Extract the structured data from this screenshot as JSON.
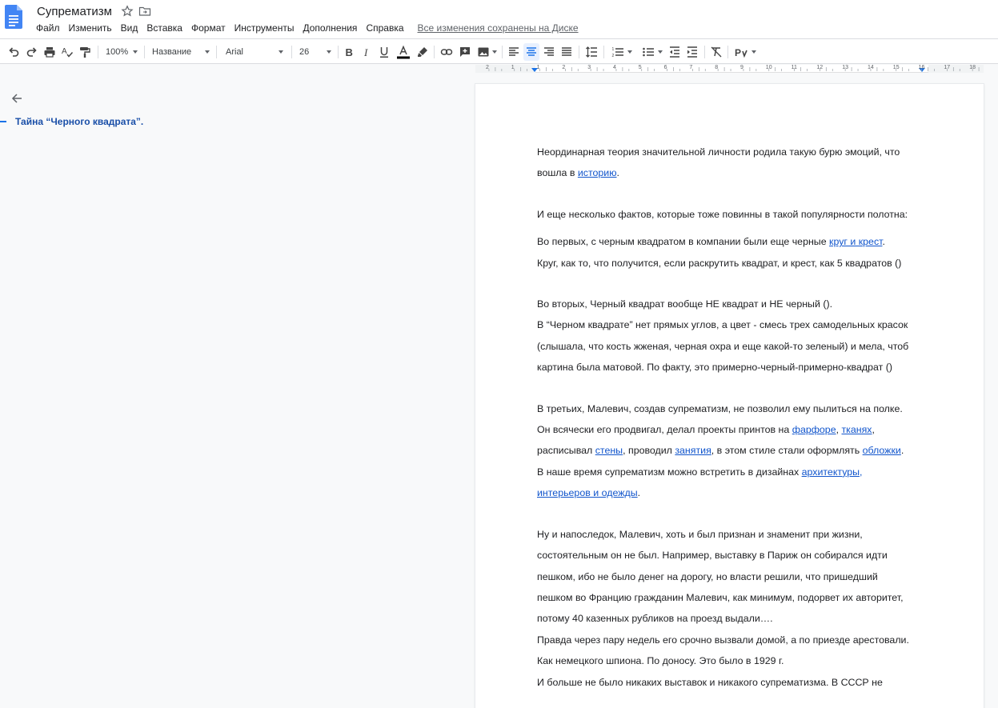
{
  "header": {
    "title": "Супрематизм",
    "menu": [
      "Файл",
      "Изменить",
      "Вид",
      "Вставка",
      "Формат",
      "Инструменты",
      "Дополнения",
      "Справка"
    ],
    "saved_status": "Все изменения сохранены на Диске"
  },
  "toolbar": {
    "zoom": "100%",
    "style": "Название",
    "font": "Arial",
    "size": "26"
  },
  "ruler": {
    "numbers": [
      "2",
      "1",
      "1",
      "2",
      "3",
      "4",
      "5",
      "6",
      "7",
      "8",
      "9",
      "10",
      "11",
      "12",
      "13",
      "14",
      "15",
      "16",
      "17",
      "18"
    ]
  },
  "outline": {
    "items": [
      "Тайна “Черного квадрата”."
    ]
  },
  "doc": {
    "p1a": "Неординарная теория значительной личности родила такую бурю эмоций, что",
    "p1b_pre": "вошла в ",
    "p1b_link": "историю",
    "p1b_post": ".",
    "p2": "И еще несколько фактов, которые тоже повинны в такой популярности полотна:",
    "p3a_pre": "Во первых, с черным квадратом в компании были еще черные ",
    "p3a_link": "круг и крест",
    "p3a_post": ".",
    "p3b": "Круг, как то, что получится, если раскрутить квадрат, и крест, как 5 квадратов ()",
    "p4a": "Во вторых, Черный квадрат вообще НЕ квадрат и НЕ черный ().",
    "p4b": "В “Черном квадрате” нет прямых углов, а цвет - смесь трех самодельных красок",
    "p4c": "(слышала, что кость жженая, черная охра и еще какой-то зеленый) и мела, чтоб",
    "p4d": "картина была матовой. По факту, это примерно-черный-примерно-квадрат ()",
    "p5a": "В третьих, Малевич, создав супрематизм, не позволил ему пылиться на полке.",
    "p5b_pre": "Он всячески его продвигал, делал проекты принтов на ",
    "p5b_link1": "фарфоре",
    "p5b_mid": ", ",
    "p5b_link2": "тканях",
    "p5b_post": ",",
    "p5c_pre": "расписывал ",
    "p5c_link1": "стены",
    "p5c_mid1": ", проводил ",
    "p5c_link2": "занятия",
    "p5c_mid2": ", в этом стиле стали оформлять ",
    "p5c_link3": "обложки",
    "p5c_post": ".",
    "p5d_pre": "В наше время супрематизм можно встретить в дизайнах ",
    "p5d_link": "архитектуры,",
    "p5e_link": "интерьеров и одежды",
    "p5e_post": ".",
    "p6a": "Ну и напоследок, Малевич, хоть и был признан и знаменит при жизни,",
    "p6b": "состоятельным он не был. Например, выставку в Париж он собирался идти",
    "p6c": "пешком, ибо не было денег на дорогу, но власти решили, что пришедший",
    "p6d": "пешком во Францию гражданин Малевич, как минимум, подорвет их авторитет,",
    "p6e": "потому 40 казенных рубликов на проезд выдали….",
    "p6f": "Правда через пару недель его срочно вызвали домой, а по приезде арестовали.",
    "p6g": "Как немецкого шпиона. По доносу. Это было в 1929 г.",
    "p6h": "И больше не было никаких выставок и никакого супрематизма. В СССР не"
  },
  "colors": {
    "accent": "#1a73e8",
    "link": "#1155cc",
    "text_color_underline": "#000000"
  }
}
